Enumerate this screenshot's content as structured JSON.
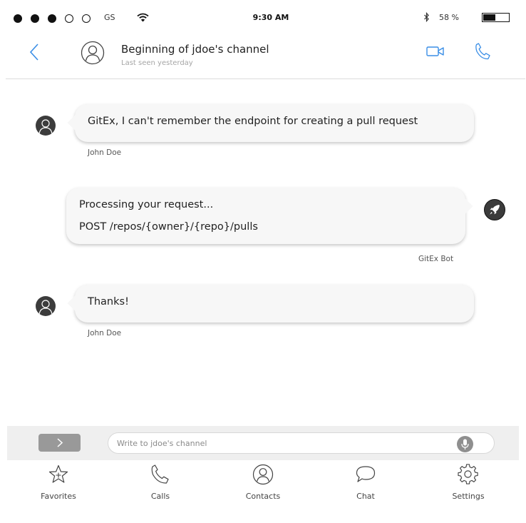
{
  "status_bar": {
    "carrier": "GS",
    "time": "9:30 AM",
    "battery_percent_label": "58 %",
    "battery_level": 0.45,
    "signal_dots_filled": 3,
    "signal_dots_total": 5
  },
  "header": {
    "title": "Beginning of jdoe's channel",
    "subtitle": "Last seen yesterday"
  },
  "messages": [
    {
      "author": "John Doe",
      "text": "GitEx, I can't remember the endpoint for creating a pull request"
    },
    {
      "author": "GitEx Bot",
      "lines": [
        "Processing your request...",
        "POST /repos/{owner}/{repo}/pulls"
      ]
    },
    {
      "author": "John Doe",
      "text": "Thanks!"
    }
  ],
  "composer": {
    "placeholder": "Write to jdoe's channel"
  },
  "tabs": [
    {
      "label": "Favorites",
      "icon": "star-icon"
    },
    {
      "label": "Calls",
      "icon": "phone-icon"
    },
    {
      "label": "Contacts",
      "icon": "contact-icon"
    },
    {
      "label": "Chat",
      "icon": "chat-bubble-icon"
    },
    {
      "label": "Settings",
      "icon": "gear-icon"
    }
  ],
  "colors": {
    "accent": "#3a8ee6",
    "bubble": "#f7f7f7",
    "composer_bg": "#efefef"
  }
}
